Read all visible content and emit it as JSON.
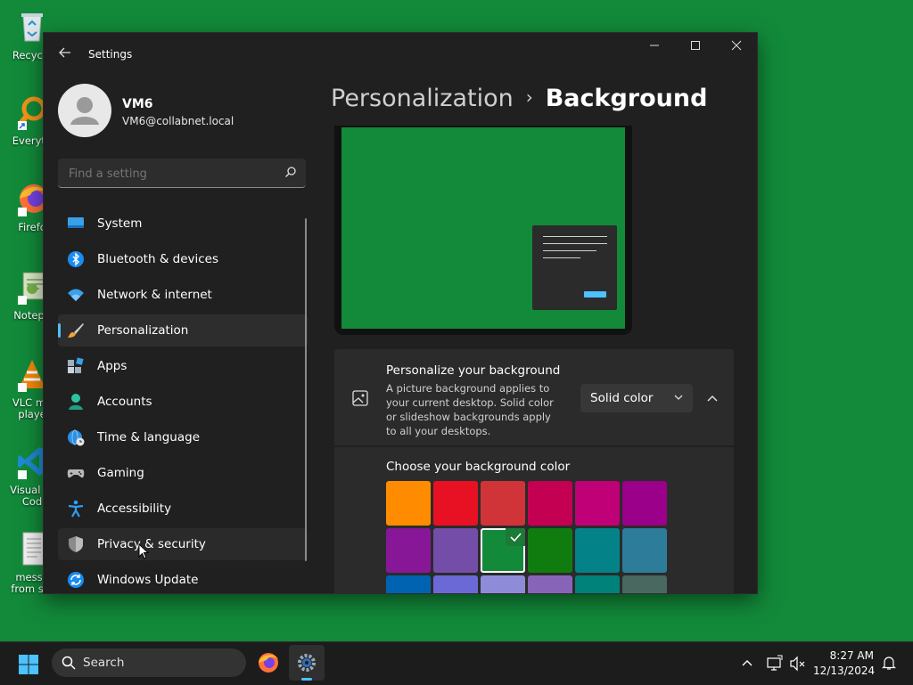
{
  "desktop": {
    "icons": [
      {
        "label": "Recycle",
        "icon": "recycle-bin-icon"
      },
      {
        "label": "Everyth",
        "icon": "everything-search-icon"
      },
      {
        "label": "Firefo",
        "icon": "firefox-icon"
      },
      {
        "label": "Notepa",
        "icon": "notepad-icon"
      },
      {
        "label_line1": "VLC me",
        "label_line2": "playe",
        "icon": "vlc-icon"
      },
      {
        "label_line1": "Visual St",
        "label_line2": "Cod",
        "icon": "vscode-icon"
      },
      {
        "label_line1": "messa",
        "label_line2": "from s...",
        "icon": "document-icon"
      }
    ],
    "background_color": "#128a3a"
  },
  "window": {
    "title": "Settings",
    "controls": {
      "minimize": "—",
      "maximize": "☐",
      "close": "✕"
    }
  },
  "profile": {
    "name": "VM6",
    "email": "VM6@collabnet.local"
  },
  "search": {
    "placeholder": "Find a setting"
  },
  "nav": {
    "items": [
      {
        "label": "System",
        "icon": "system-icon"
      },
      {
        "label": "Bluetooth & devices",
        "icon": "bluetooth-icon"
      },
      {
        "label": "Network & internet",
        "icon": "wifi-icon"
      },
      {
        "label": "Personalization",
        "icon": "brush-icon",
        "selected": true
      },
      {
        "label": "Apps",
        "icon": "apps-icon"
      },
      {
        "label": "Accounts",
        "icon": "person-icon"
      },
      {
        "label": "Time & language",
        "icon": "globe-clock-icon"
      },
      {
        "label": "Gaming",
        "icon": "gamepad-icon"
      },
      {
        "label": "Accessibility",
        "icon": "accessibility-icon"
      },
      {
        "label": "Privacy & security",
        "icon": "shield-icon"
      },
      {
        "label": "Windows Update",
        "icon": "update-icon"
      }
    ]
  },
  "breadcrumb": {
    "parent": "Personalization",
    "separator": "›",
    "current": "Background"
  },
  "personalize": {
    "title": "Personalize your background",
    "description": "A picture background applies to your current desktop. Solid color or slideshow backgrounds apply to all your desktops.",
    "dropdown_value": "Solid color"
  },
  "color_picker": {
    "title": "Choose your background color",
    "selected_index": 8,
    "colors": [
      "#ff8c00",
      "#e81123",
      "#d13438",
      "#c30052",
      "#bf0077",
      "#9a0089",
      "#881798",
      "#744da9",
      "#128a3a",
      "#107c10",
      "#038387",
      "#2d7d9a",
      "#0063b1",
      "#6b69d6",
      "#8e8cd8",
      "#8764b8",
      "#00827a",
      "#486860"
    ]
  },
  "taskbar": {
    "search_label": "Search",
    "time": "8:27 AM",
    "date": "12/13/2024"
  },
  "accent_color": "#4cc2ff"
}
